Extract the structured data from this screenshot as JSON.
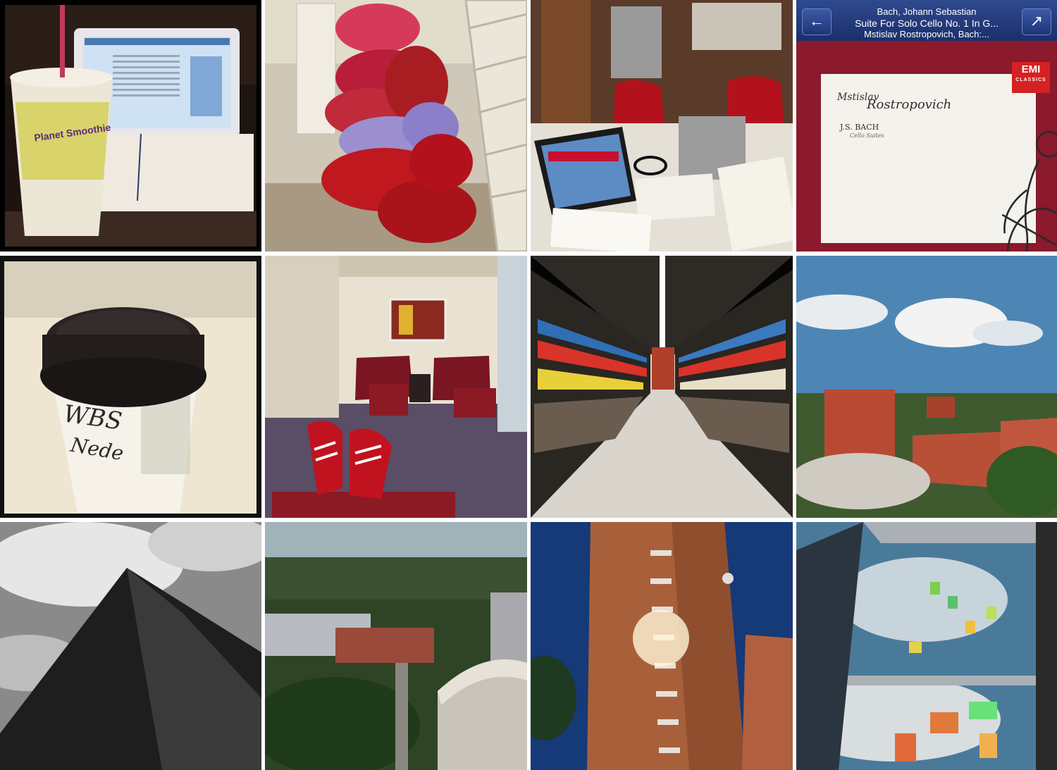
{
  "collage": {
    "tiles": [
      {
        "subject": "smoothie cup beside laptop and bound notes"
      },
      {
        "subject": "pile of red and purple sleeping bags by library shelves"
      },
      {
        "subject": "study carrel with laptop, headphones and papers"
      },
      {
        "subject": "music player showing album cover"
      },
      {
        "subject": "coffee cup with handwritten name"
      },
      {
        "subject": "lounge with red leather armchairs and red sneakers"
      },
      {
        "subject": "library stacks aisle"
      },
      {
        "subject": "campus skyline with clouds"
      },
      {
        "subject": "black and white tower from below"
      },
      {
        "subject": "aerial view of campus trees and buildings"
      },
      {
        "subject": "brick tower with sun flare"
      },
      {
        "subject": "window reflection with colored panels"
      }
    ]
  },
  "smoothie_cup": {
    "brand": "Planet Smoothie"
  },
  "coffee_cup": {
    "handwriting_1": "WBS",
    "handwriting_2": "Nede"
  },
  "music_player": {
    "artist": "Bach, Johann Sebastian",
    "track": "Suite For Solo Cello No. 1 In G...",
    "album": "Mstislav Rostropovich, Bach:...",
    "back_icon": "arrow-left-icon",
    "expand_icon": "expand-arrow-icon"
  },
  "album_cover": {
    "performer_first": "Mstislav",
    "performer_last": "Rostropovich",
    "composer": "J.S. BACH",
    "subtitle": "Cello Suites",
    "label": "EMI",
    "label_sub": "CLASSICS"
  },
  "colors": {
    "album_red": "#8a1a2c",
    "player_blue": "#2f4a8f",
    "sneaker_red": "#c1121f"
  }
}
